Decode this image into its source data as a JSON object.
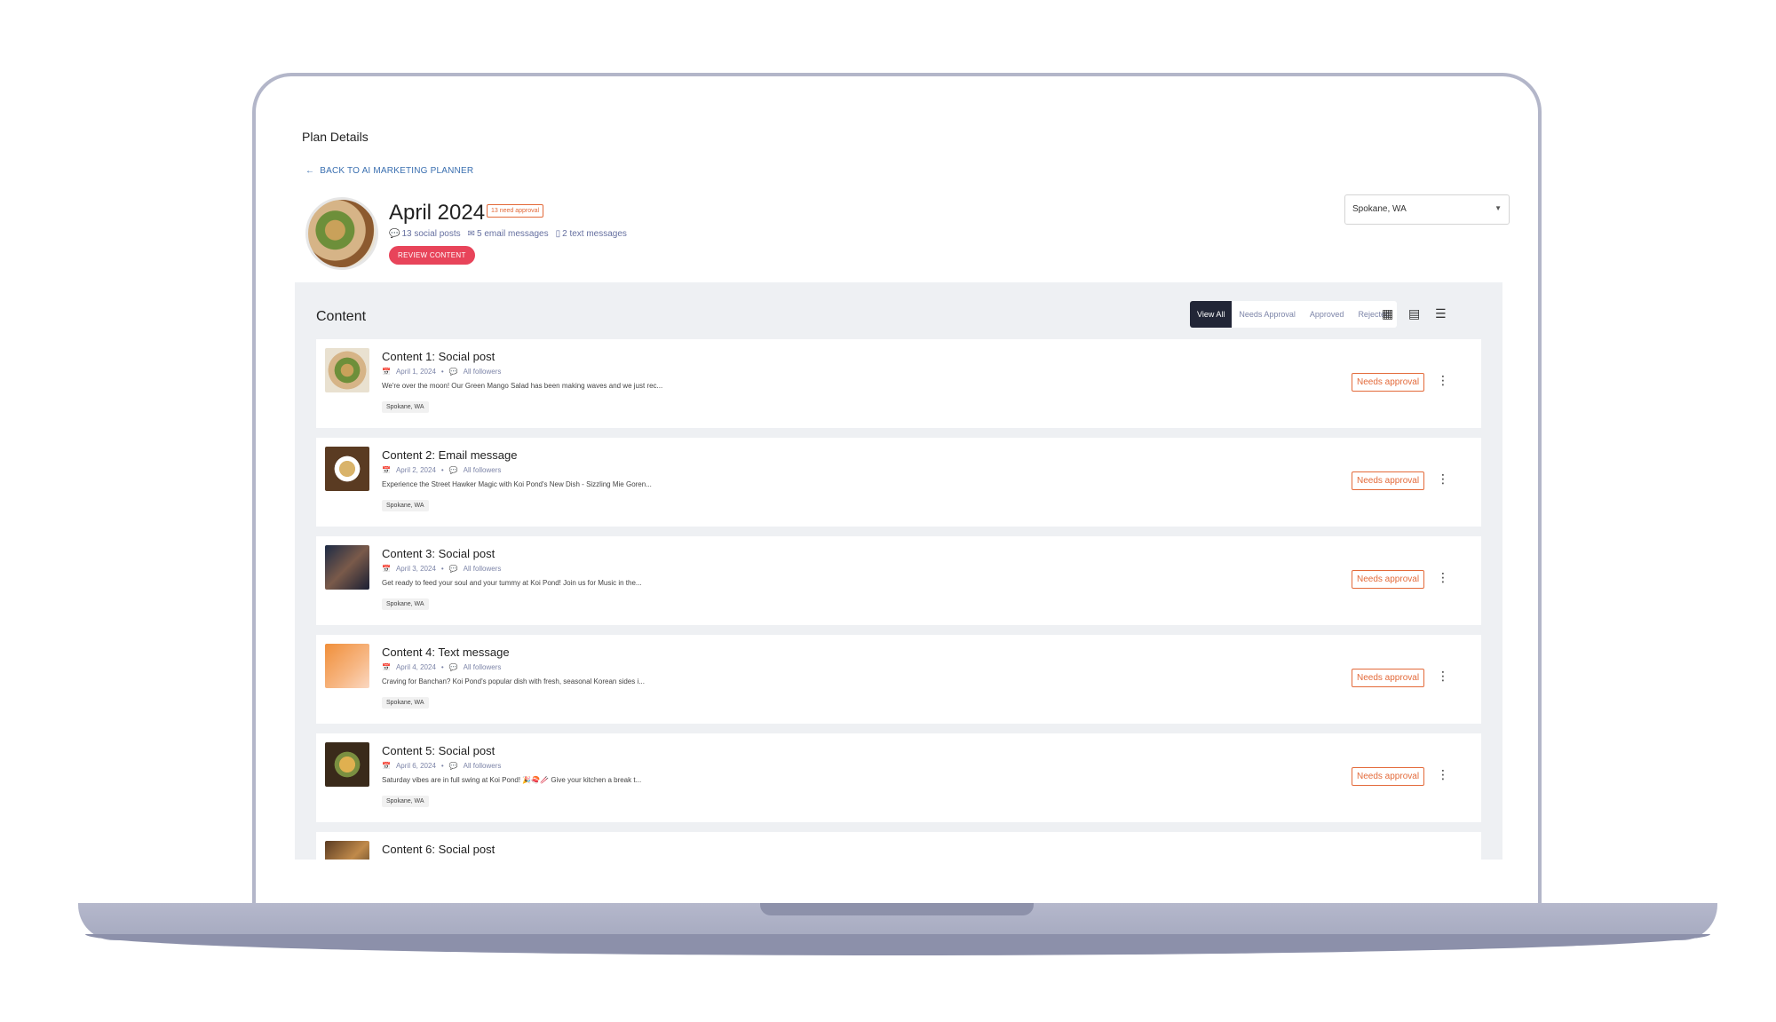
{
  "page": {
    "title": "Plan Details",
    "back_link": "BACK TO AI MARKETING PLANNER"
  },
  "plan": {
    "month": "April 2024",
    "approval_chip": "13 need approval",
    "stats": {
      "social": "13 social posts",
      "email": "5 email messages",
      "text": "2 text messages"
    },
    "review_button": "REVIEW CONTENT",
    "location": "Spokane, WA"
  },
  "content": {
    "heading": "Content",
    "filters": [
      "View All",
      "Needs Approval",
      "Approved",
      "Rejected"
    ],
    "rows": [
      {
        "title": "Content 1: Social post",
        "date": "April 1, 2024",
        "audience": "All followers",
        "text": "We're over the moon! Our Green Mango Salad has been making waves and we just rec...",
        "tag": "Spokane, WA",
        "status": "Needs approval"
      },
      {
        "title": "Content 2: Email message",
        "date": "April 2, 2024",
        "audience": "All followers",
        "text": "Experience the Street Hawker Magic with Koi Pond's New Dish - Sizzling Mie Goren...",
        "tag": "Spokane, WA",
        "status": "Needs approval"
      },
      {
        "title": "Content 3: Social post",
        "date": "April 3, 2024",
        "audience": "All followers",
        "text": "Get ready to feed your soul and your tummy at Koi Pond! Join us for Music in the...",
        "tag": "Spokane, WA",
        "status": "Needs approval"
      },
      {
        "title": "Content 4: Text message",
        "date": "April 4, 2024",
        "audience": "All followers",
        "text": "Craving for Banchan? Koi Pond's popular dish with fresh, seasonal Korean sides i...",
        "tag": "Spokane, WA",
        "status": "Needs approval"
      },
      {
        "title": "Content 5: Social post",
        "date": "April 6, 2024",
        "audience": "All followers",
        "text": "Saturday vibes are in full swing at Koi Pond! 🎉🍣🥢 Give your kitchen a break t...",
        "tag": "Spokane, WA",
        "status": "Needs approval"
      },
      {
        "title": "Content 6: Social post"
      }
    ]
  },
  "colors": {
    "accent": "#e8445a",
    "status": "#e36a3a",
    "active_filter": "#222637"
  }
}
